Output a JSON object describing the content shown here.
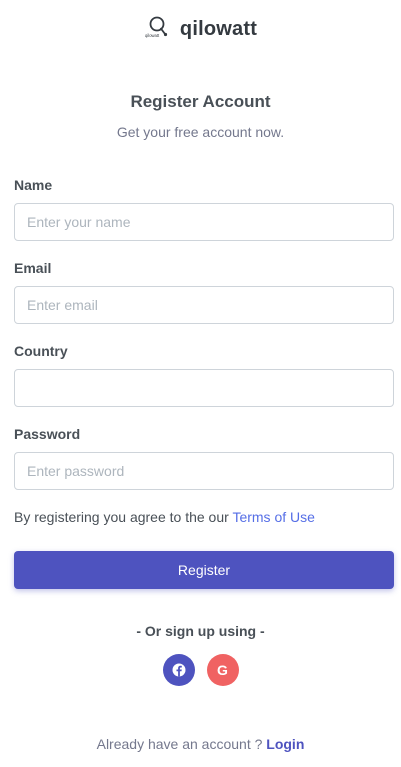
{
  "brand": {
    "name": "qilowatt",
    "logo_text": "qilowatt"
  },
  "header": {
    "title": "Register Account",
    "subtitle": "Get your free account now."
  },
  "form": {
    "name": {
      "label": "Name",
      "placeholder": "Enter your name",
      "value": ""
    },
    "email": {
      "label": "Email",
      "placeholder": "Enter email",
      "value": ""
    },
    "country": {
      "label": "Country",
      "placeholder": "",
      "value": ""
    },
    "password": {
      "label": "Password",
      "placeholder": "Enter password",
      "value": ""
    }
  },
  "terms": {
    "text": "By registering you agree to the our ",
    "link": "Terms of Use"
  },
  "register_button": {
    "label": "Register"
  },
  "social": {
    "divider_text": "Or sign up using",
    "dash": "-",
    "buttons": [
      {
        "icon": "facebook-icon",
        "color": "#4e53bf"
      },
      {
        "icon": "google-icon",
        "label": "G",
        "color": "#f06262"
      }
    ]
  },
  "footer": {
    "text": "Already have an account ? ",
    "link": "Login"
  },
  "colors": {
    "primary": "#4e53bf",
    "link": "#556ee6",
    "google": "#f06262",
    "text_muted": "#74788d",
    "border": "#ced4da"
  }
}
